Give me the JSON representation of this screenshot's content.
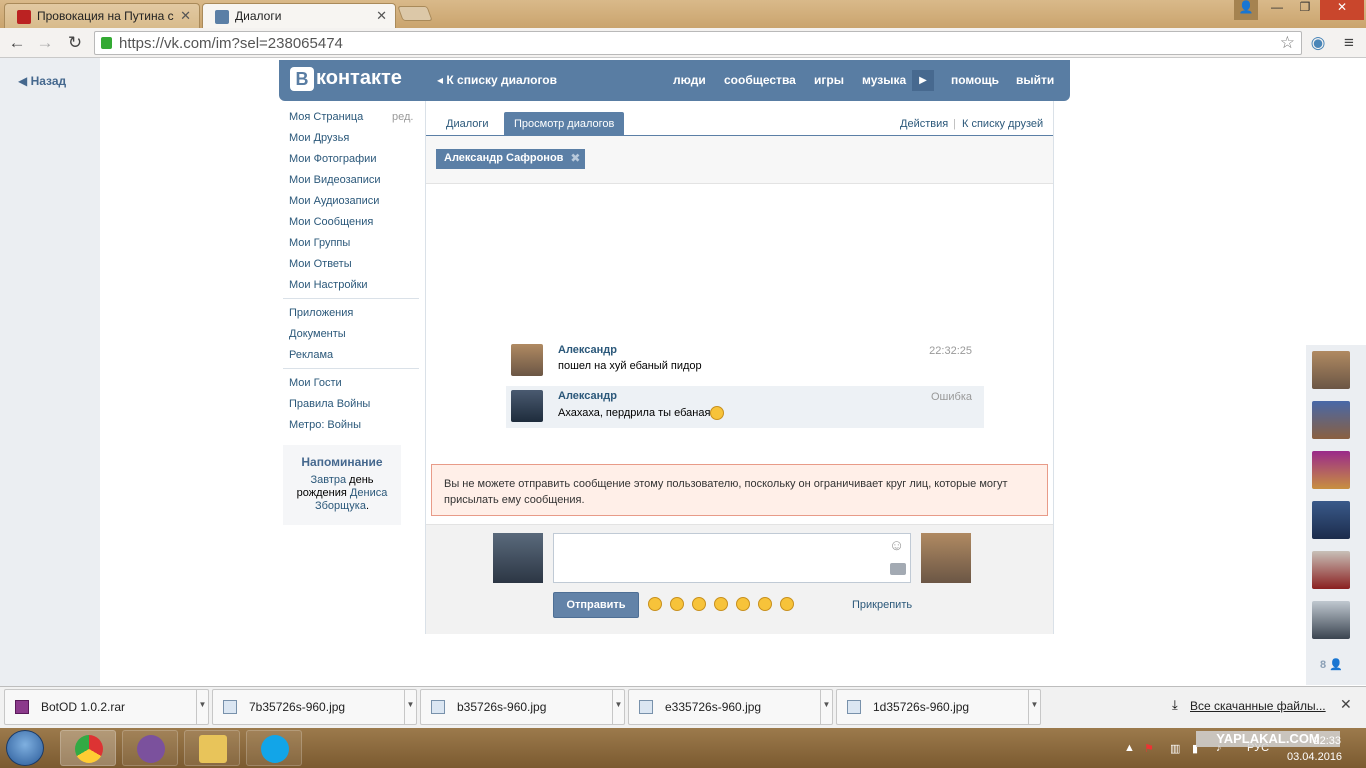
{
  "browser": {
    "tabs": [
      {
        "title": "Провокация на Путина с"
      },
      {
        "title": "Диалоги"
      }
    ],
    "url": "https://vk.com/im?sel=238065474"
  },
  "sidebar_back": "Назад",
  "vk": {
    "logo_b": "В",
    "logo_text": "контакте",
    "dialogs_link": "К списку диалогов",
    "nav": [
      "люди",
      "сообщества",
      "игры",
      "музыка",
      "помощь",
      "выйти"
    ],
    "left_menu": [
      {
        "label": "Моя Страница"
      },
      {
        "label": "Мои Друзья"
      },
      {
        "label": "Мои Фотографии"
      },
      {
        "label": "Мои Видеозаписи"
      },
      {
        "label": "Мои Аудиозаписи"
      },
      {
        "label": "Мои Сообщения"
      },
      {
        "label": "Мои Группы"
      },
      {
        "label": "Мои Ответы"
      },
      {
        "label": "Мои Настройки"
      }
    ],
    "edit_label": "ред.",
    "left_menu2": [
      "Приложения",
      "Документы",
      "Реклама"
    ],
    "left_menu3": [
      "Мои Гости",
      "Правила Войны",
      "Метро: Войны"
    ],
    "reminder": {
      "title": "Напоминание",
      "word1": "Завтра",
      "word2": "день",
      "word3": "рождения",
      "name1": "Дениса",
      "name2": "Зборщука",
      "dot": "."
    },
    "page_tabs": [
      "Диалоги",
      "Просмотр диалогов"
    ],
    "actions": "Действия",
    "friends_link": "К списку друзей",
    "actions_sep": "|",
    "peer_chip": "Александр Сафронов",
    "messages": [
      {
        "author": "Александр",
        "text": "пошел на хуй ебаный пидор",
        "time": "22:32:25"
      },
      {
        "author": "Александр",
        "text": "Ахахаха, пердрила ты ебаная",
        "time": "Ошибка"
      }
    ],
    "error_text": "Вы не можете отправить сообщение этому пользователю, поскольку он ограничивает круг лиц, которые могут присылать ему сообщения.",
    "send_label": "Отправить",
    "attach_label": "Прикрепить",
    "online_count": "8"
  },
  "downloads": {
    "items": [
      "BotOD 1.0.2.rar",
      "7b35726s-960.jpg",
      "b35726s-960.jpg",
      "e335726s-960.jpg",
      "1d35726s-960.jpg"
    ],
    "all_label": "Все скачанные файлы..."
  },
  "taskbar": {
    "lang": "РУС",
    "time": "22:33",
    "date": "03.04.2016",
    "watermark": "YAPLAKAL.COM"
  }
}
